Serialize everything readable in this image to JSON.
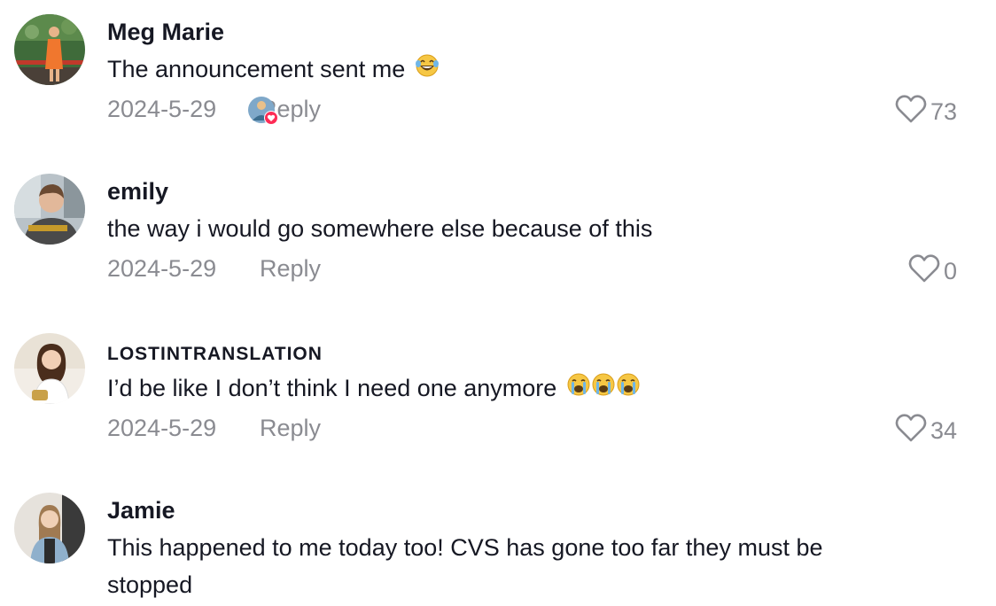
{
  "comments": [
    {
      "username": "Meg Marie",
      "text": "The announcement sent me",
      "emoji": "laughing-crying-emoji",
      "date": "2024-5-29",
      "reply_label": "Reply",
      "likes": "73",
      "creator_liked": true
    },
    {
      "username": "emily",
      "text": "the way i would go somewhere else because of this",
      "date": "2024-5-29",
      "reply_label": "Reply",
      "likes": "0"
    },
    {
      "username": "LOSTINTRANSLATION",
      "text": "I’d be like I don’t think I need one anymore",
      "emoji": "loudly-crying-emoji",
      "date": "2024-5-29",
      "reply_label": "Reply",
      "likes": "34"
    },
    {
      "username": "Jamie",
      "text": "This happened to me today too! CVS has gone too far they must be stopped"
    }
  ],
  "colors": {
    "text": "#161823",
    "muted": "#8a8b91",
    "heart_badge": "#fe2c55"
  }
}
